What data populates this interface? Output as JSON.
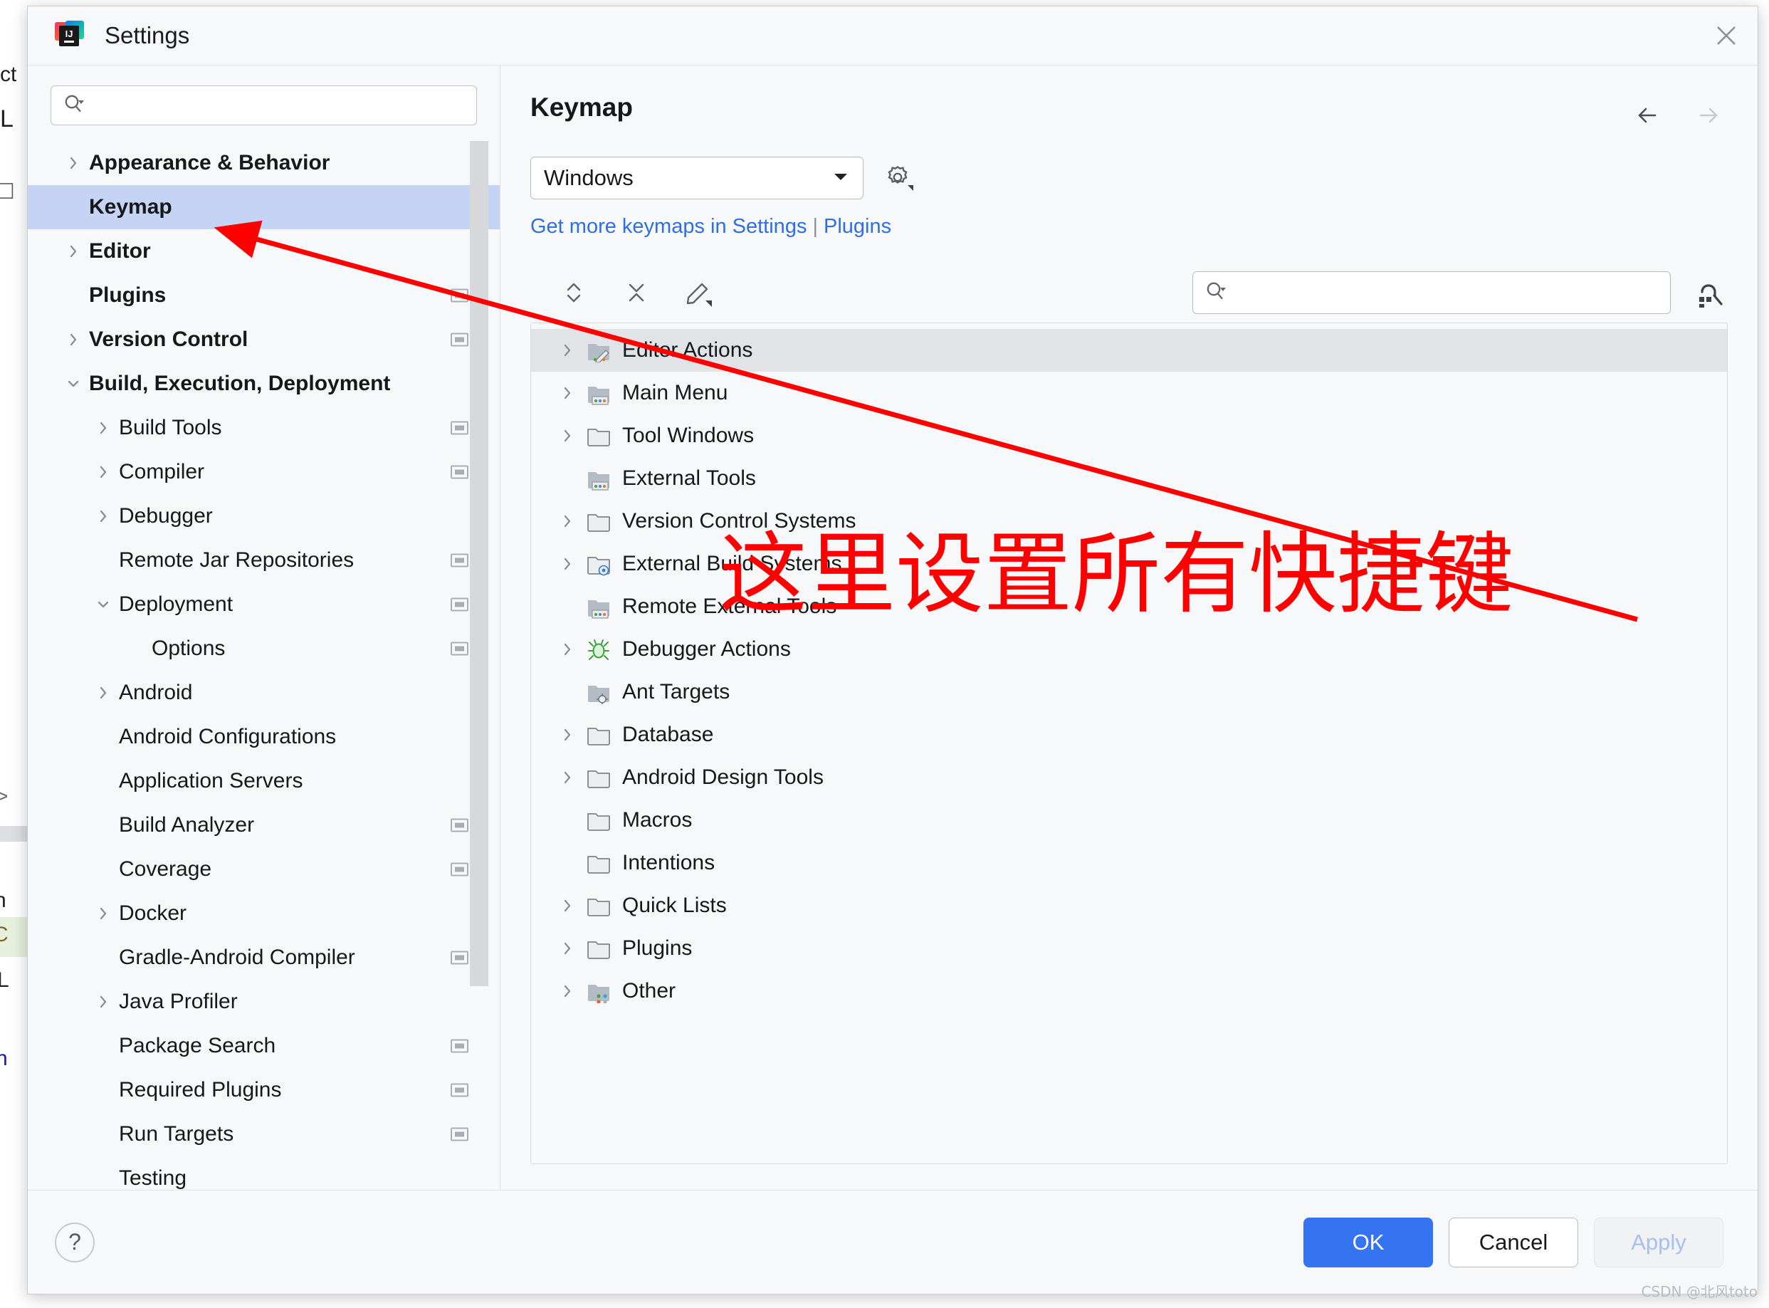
{
  "window": {
    "title": "Settings",
    "logo_text": "IJ",
    "close_icon": "close-icon"
  },
  "sidebar": {
    "search_placeholder": "",
    "search_value": "",
    "items": [
      {
        "label": "Appearance & Behavior",
        "level": 0,
        "arrow": "right",
        "bold": true,
        "badge": false,
        "selected": false
      },
      {
        "label": "Keymap",
        "level": 0,
        "arrow": "none",
        "bold": true,
        "badge": false,
        "selected": true
      },
      {
        "label": "Editor",
        "level": 0,
        "arrow": "right",
        "bold": true,
        "badge": false,
        "selected": false
      },
      {
        "label": "Plugins",
        "level": 0,
        "arrow": "none",
        "bold": true,
        "badge": true,
        "selected": false
      },
      {
        "label": "Version Control",
        "level": 0,
        "arrow": "right",
        "bold": true,
        "badge": true,
        "selected": false
      },
      {
        "label": "Build, Execution, Deployment",
        "level": 0,
        "arrow": "down",
        "bold": true,
        "badge": false,
        "selected": false
      },
      {
        "label": "Build Tools",
        "level": 1,
        "arrow": "right",
        "bold": false,
        "badge": true,
        "selected": false
      },
      {
        "label": "Compiler",
        "level": 1,
        "arrow": "right",
        "bold": false,
        "badge": true,
        "selected": false
      },
      {
        "label": "Debugger",
        "level": 1,
        "arrow": "right",
        "bold": false,
        "badge": false,
        "selected": false
      },
      {
        "label": "Remote Jar Repositories",
        "level": 1,
        "arrow": "none",
        "bold": false,
        "badge": true,
        "selected": false
      },
      {
        "label": "Deployment",
        "level": 1,
        "arrow": "down",
        "bold": false,
        "badge": true,
        "selected": false
      },
      {
        "label": "Options",
        "level": 2,
        "arrow": "none",
        "bold": false,
        "badge": true,
        "selected": false
      },
      {
        "label": "Android",
        "level": 1,
        "arrow": "right",
        "bold": false,
        "badge": false,
        "selected": false
      },
      {
        "label": "Android Configurations",
        "level": 1,
        "arrow": "none",
        "bold": false,
        "badge": false,
        "selected": false
      },
      {
        "label": "Application Servers",
        "level": 1,
        "arrow": "none",
        "bold": false,
        "badge": false,
        "selected": false
      },
      {
        "label": "Build Analyzer",
        "level": 1,
        "arrow": "none",
        "bold": false,
        "badge": true,
        "selected": false
      },
      {
        "label": "Coverage",
        "level": 1,
        "arrow": "none",
        "bold": false,
        "badge": true,
        "selected": false
      },
      {
        "label": "Docker",
        "level": 1,
        "arrow": "right",
        "bold": false,
        "badge": false,
        "selected": false
      },
      {
        "label": "Gradle-Android Compiler",
        "level": 1,
        "arrow": "none",
        "bold": false,
        "badge": true,
        "selected": false
      },
      {
        "label": "Java Profiler",
        "level": 1,
        "arrow": "right",
        "bold": false,
        "badge": false,
        "selected": false
      },
      {
        "label": "Package Search",
        "level": 1,
        "arrow": "none",
        "bold": false,
        "badge": true,
        "selected": false
      },
      {
        "label": "Required Plugins",
        "level": 1,
        "arrow": "none",
        "bold": false,
        "badge": true,
        "selected": false
      },
      {
        "label": "Run Targets",
        "level": 1,
        "arrow": "none",
        "bold": false,
        "badge": true,
        "selected": false
      },
      {
        "label": "Testing",
        "level": 1,
        "arrow": "none",
        "bold": false,
        "badge": false,
        "selected": false
      }
    ]
  },
  "keymap_page": {
    "title": "Keymap",
    "back_icon": "arrow-left-icon",
    "forward_icon": "arrow-right-icon",
    "selected_keymap": "Windows",
    "gear_icon": "gear-icon",
    "links_prefix": "Get more keymaps in Settings",
    "links_separator": "|",
    "links_suffix": "Plugins",
    "toolbar": {
      "expand_all_icon": "expand-all-icon",
      "collapse_all_icon": "collapse-all-icon",
      "edit_shortcut_icon": "edit-pencil-icon",
      "find_by_shortcut_icon": "find-by-shortcut-icon"
    },
    "search_placeholder": "",
    "search_value": "",
    "tree": [
      {
        "label": "Editor Actions",
        "arrow": "right",
        "icon": "folder-editor-icon",
        "selected": true
      },
      {
        "label": "Main Menu",
        "arrow": "right",
        "icon": "folder-menu-icon",
        "selected": false
      },
      {
        "label": "Tool Windows",
        "arrow": "right",
        "icon": "folder-plain-icon",
        "selected": false
      },
      {
        "label": "External Tools",
        "arrow": "none",
        "icon": "folder-menu-icon",
        "selected": false
      },
      {
        "label": "Version Control Systems",
        "arrow": "right",
        "icon": "folder-plain-icon",
        "selected": false
      },
      {
        "label": "External Build Systems",
        "arrow": "right",
        "icon": "folder-gear-icon",
        "selected": false
      },
      {
        "label": "Remote External Tools",
        "arrow": "none",
        "icon": "folder-menu-icon",
        "selected": false
      },
      {
        "label": "Debugger Actions",
        "arrow": "right",
        "icon": "bug-icon",
        "selected": false
      },
      {
        "label": "Ant Targets",
        "arrow": "none",
        "icon": "folder-ant-icon",
        "selected": false
      },
      {
        "label": "Database",
        "arrow": "right",
        "icon": "folder-plain-icon",
        "selected": false
      },
      {
        "label": "Android Design Tools",
        "arrow": "right",
        "icon": "folder-plain-icon",
        "selected": false
      },
      {
        "label": "Macros",
        "arrow": "none",
        "icon": "folder-plain-icon",
        "selected": false
      },
      {
        "label": "Intentions",
        "arrow": "none",
        "icon": "folder-plain-icon",
        "selected": false
      },
      {
        "label": "Quick Lists",
        "arrow": "right",
        "icon": "folder-plain-icon",
        "selected": false
      },
      {
        "label": "Plugins",
        "arrow": "right",
        "icon": "folder-plain-icon",
        "selected": false
      },
      {
        "label": "Other",
        "arrow": "right",
        "icon": "folder-dots-icon",
        "selected": false
      }
    ]
  },
  "footer": {
    "help_label": "?",
    "ok_label": "OK",
    "cancel_label": "Cancel",
    "apply_label": "Apply"
  },
  "annotation": {
    "text": "这里设置所有快捷键",
    "color": "#ff0000"
  },
  "watermark": "CSDN @北风toto",
  "colors": {
    "selection_blue": "#c5d3f5",
    "primary_button": "#3574f0",
    "link_blue": "#2f6fe0",
    "annotation_red": "#ff0000"
  }
}
